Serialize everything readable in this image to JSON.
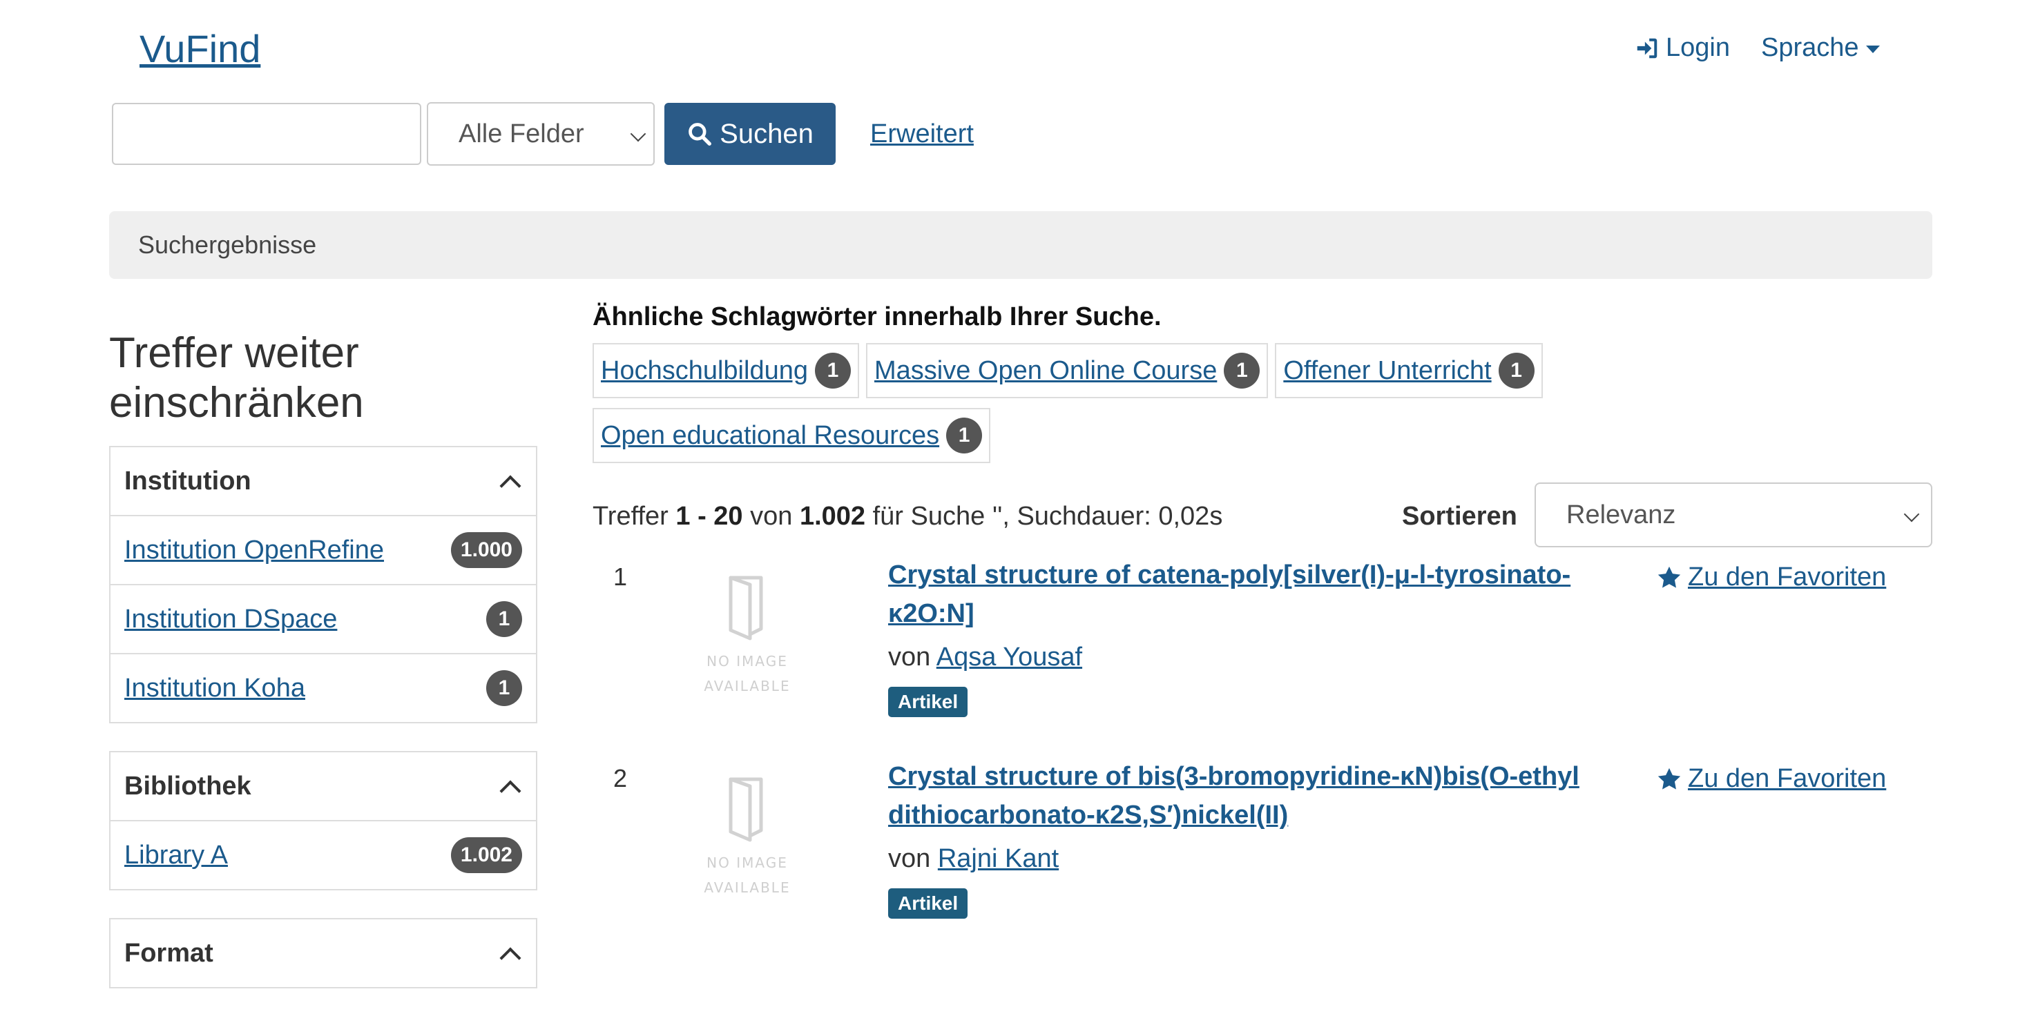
{
  "header": {
    "brand": "VuFind",
    "login_label": "Login",
    "language_label": "Sprache"
  },
  "search": {
    "input_value": "",
    "type_selected": "Alle Felder",
    "button_label": "Suchen",
    "advanced_label": "Erweitert"
  },
  "breadcrumb": {
    "label": "Suchergebnisse"
  },
  "sidebar": {
    "title_line1": "Treffer weiter",
    "title_line2": "einschränken",
    "facets": [
      {
        "title": "Institution",
        "items": [
          {
            "label": "Institution OpenRefine",
            "count": "1.000"
          },
          {
            "label": "Institution DSpace",
            "count": "1"
          },
          {
            "label": "Institution Koha",
            "count": "1"
          }
        ]
      },
      {
        "title": "Bibliothek",
        "items": [
          {
            "label": "Library A",
            "count": "1.002"
          }
        ]
      },
      {
        "title": "Format",
        "items": []
      }
    ]
  },
  "main": {
    "similar_title": "Ähnliche Schlagwörter innerhalb Ihrer Suche.",
    "tags": [
      {
        "label": "Hochschulbildung",
        "count": "1"
      },
      {
        "label": "Massive Open Online Course",
        "count": "1"
      },
      {
        "label": "Offener Unterricht",
        "count": "1"
      },
      {
        "label": "Open educational Resources",
        "count": "1"
      }
    ],
    "stats": {
      "prefix": "Treffer",
      "range": "1 - 20",
      "of": "von",
      "total": "1.002",
      "suffix": "für Suche '', Suchdauer: 0,02s"
    },
    "sort": {
      "label": "Sortieren",
      "selected": "Relevanz"
    },
    "thumb_text_line1": "NO IMAGE",
    "thumb_text_line2": "AVAILABLE",
    "results": [
      {
        "num": "1",
        "title": "Crystal structure of catena-poly[silver(I)-μ-l-tyrosinato-κ2O:N]",
        "author_prefix": "von",
        "author": "Aqsa Yousaf",
        "format": "Artikel",
        "fav_label": "Zu den Favoriten"
      },
      {
        "num": "2",
        "title": "Crystal structure of bis(3-bromopyridine-κN)bis(O-ethyl dithiocarbonato-κ2S,S′)nickel(II)",
        "author_prefix": "von",
        "author": "Rajni Kant",
        "format": "Artikel",
        "fav_label": "Zu den Favoriten"
      }
    ]
  }
}
